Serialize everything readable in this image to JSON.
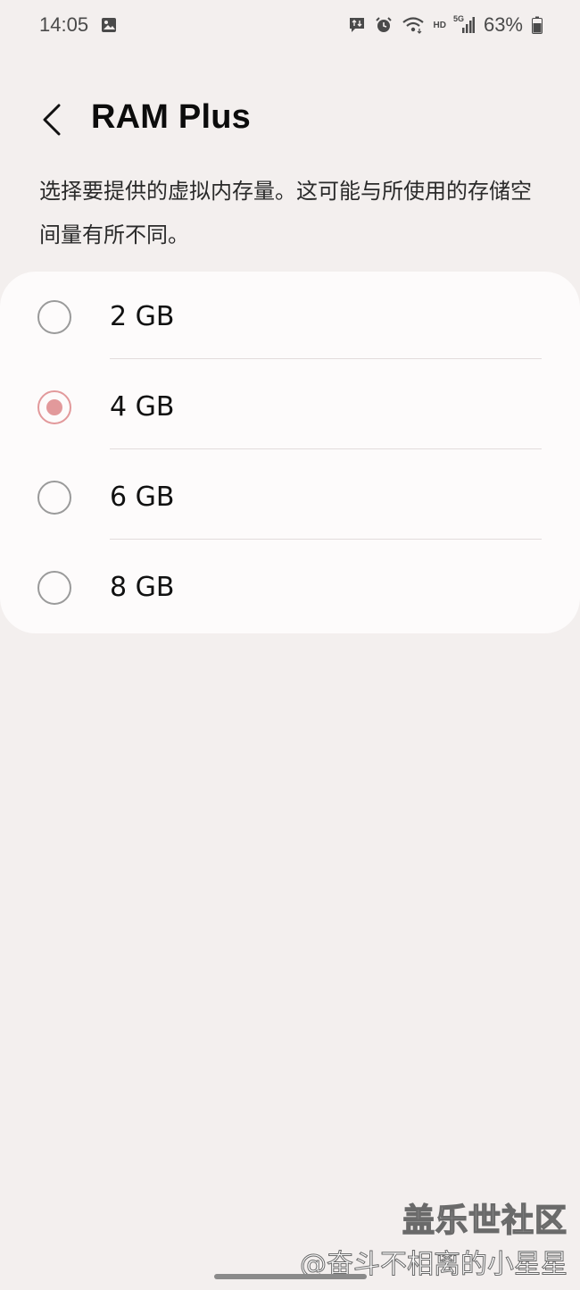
{
  "status_bar": {
    "time": "14:05",
    "battery_percent": "63%",
    "hd_label": "HD",
    "network_label": "5G",
    "icons": [
      "image-icon",
      "message-icon",
      "alarm-icon",
      "wifi-icon",
      "signal-icon",
      "battery-icon"
    ]
  },
  "header": {
    "back_icon": "chevron-left-icon",
    "title": "RAM Plus"
  },
  "description": "选择要提供的虚拟内存量。这可能与所使用的存储空间量有所不同。",
  "options": [
    {
      "label": "2 GB",
      "selected": false
    },
    {
      "label": "4 GB",
      "selected": true
    },
    {
      "label": "6 GB",
      "selected": false
    },
    {
      "label": "8 GB",
      "selected": false
    }
  ],
  "accent_color": "#e2999b",
  "watermark": {
    "line1": "盖乐世社区",
    "line2": "@奋斗不相离的小星星"
  }
}
